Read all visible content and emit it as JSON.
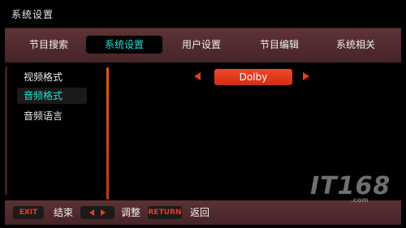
{
  "window": {
    "title": "系统设置"
  },
  "tabs": [
    {
      "label": "节目搜索",
      "active": false
    },
    {
      "label": "系统设置",
      "active": true
    },
    {
      "label": "用户设置",
      "active": false
    },
    {
      "label": "节目编辑",
      "active": false
    },
    {
      "label": "系统相关",
      "active": false
    }
  ],
  "menu": {
    "items": [
      {
        "label": "视频格式",
        "active": false
      },
      {
        "label": "音频格式",
        "active": true
      },
      {
        "label": "音频语言",
        "active": false
      }
    ]
  },
  "setting": {
    "value": "Dolby"
  },
  "footer": {
    "exit_key": "EXIT",
    "exit_label": "结束",
    "adjust_label": "调整",
    "return_key": "RETURN",
    "return_label": "返回"
  },
  "watermark": {
    "main": "IT168",
    "sub": ".com"
  },
  "colors": {
    "accent": "#e73b20",
    "active_text": "#20e0d8",
    "bar": "#5e3336",
    "divider": "#e2591c"
  }
}
